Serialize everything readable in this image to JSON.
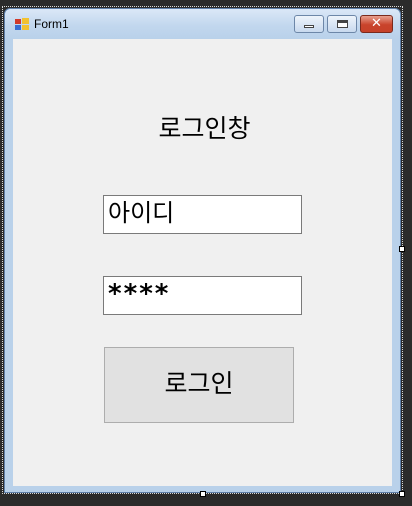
{
  "window": {
    "title": "Form1",
    "close_glyph": "✕"
  },
  "form": {
    "heading": "로그인창",
    "id_field": {
      "value": "아이디"
    },
    "password_field": {
      "value": "****"
    },
    "login_button": {
      "label": "로그인"
    }
  },
  "colors": {
    "client_background": "#f0f0f0",
    "button_background": "#e1e1e1",
    "titlebar": "#b9d1ea",
    "close_button": "#c9432b"
  },
  "icons": [
    "app-form-icon",
    "minimize-icon",
    "maximize-icon",
    "close-icon"
  ]
}
